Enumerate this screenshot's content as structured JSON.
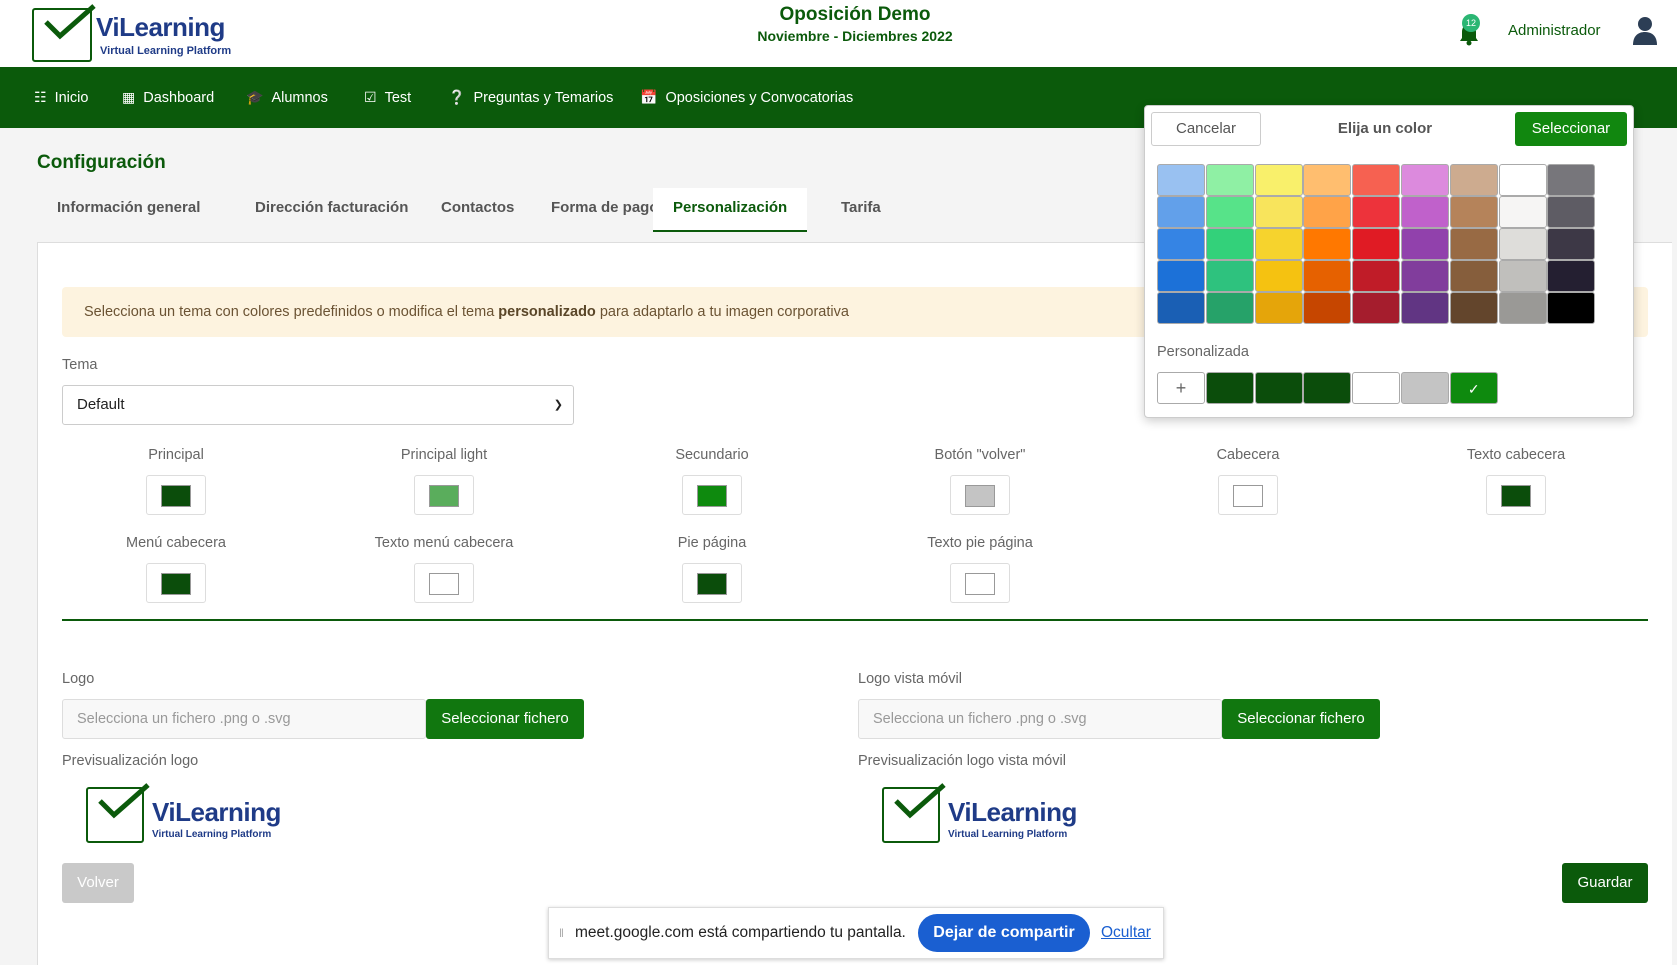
{
  "header": {
    "logo": {
      "title_vi": "Vi",
      "title_learning": "Learning",
      "subtitle": "Virtual Learning Platform"
    },
    "exam_title": "Oposición Demo",
    "exam_dates": "Noviembre - Diciembres 2022",
    "notification_count": "12",
    "user_name": "Administrador"
  },
  "nav": {
    "items": [
      {
        "label": "Inicio",
        "icon": "grid-icon"
      },
      {
        "label": "Dashboard",
        "icon": "dashboard-icon"
      },
      {
        "label": "Alumnos",
        "icon": "graduation-cap-icon"
      },
      {
        "label": "Test",
        "icon": "checkbox-icon"
      },
      {
        "label": "Preguntas y Temarios",
        "icon": "question-circle-icon"
      },
      {
        "label": "Oposiciones y Convocatorias",
        "icon": "calendar-icon"
      }
    ]
  },
  "page": {
    "title": "Configuración",
    "tabs": [
      {
        "label": "Información general"
      },
      {
        "label": "Dirección facturación"
      },
      {
        "label": "Contactos"
      },
      {
        "label": "Forma de pago"
      },
      {
        "label": "Personalización"
      },
      {
        "label": "Tarifa"
      }
    ],
    "active_tab": "Personalización"
  },
  "personalization": {
    "alert_pre": "Selecciona un tema con colores predefinidos o modifica el tema ",
    "alert_bold": "personalizado",
    "alert_post": " para adaptarlo a tu imagen corporativa",
    "theme_label": "Tema",
    "theme_value": "Default",
    "colors": [
      {
        "name": "Principal",
        "color": "#0b4d0b"
      },
      {
        "name": "Principal light",
        "color": "#5aad5c"
      },
      {
        "name": "Secundario",
        "color": "#0e8a0e"
      },
      {
        "name": "Botón \"volver\"",
        "color": "#c4c4c4"
      },
      {
        "name": "Cabecera",
        "color": "#ffffff"
      },
      {
        "name": "Texto cabecera",
        "color": "#0b4d0b"
      },
      {
        "name": "Menú cabecera",
        "color": "#0b4d0b"
      },
      {
        "name": "Texto menú cabecera",
        "color": "#ffffff"
      },
      {
        "name": "Pie página",
        "color": "#0b4d0b"
      },
      {
        "name": "Texto pie página",
        "color": "#ffffff"
      }
    ],
    "logo_label": "Logo",
    "logo_mobile_label": "Logo vista móvil",
    "file_placeholder": "Selecciona un fichero .png o .svg",
    "file_button": "Seleccionar fichero",
    "preview_logo_label": "Previsualización logo",
    "preview_logo_mobile_label": "Previsualización logo vista móvil",
    "back_button": "Volver",
    "save_button": "Guardar"
  },
  "color_picker": {
    "cancel_label": "Cancelar",
    "title": "Elija un color",
    "select_label": "Seleccionar",
    "custom_label": "Personalizada",
    "add_symbol": "+",
    "palette": [
      [
        "#99c1f1",
        "#8ff0a4",
        "#f9f06b",
        "#ffbe6f",
        "#f66151",
        "#dc8add",
        "#cdab8f",
        "#ffffff",
        "#77767b"
      ],
      [
        "#62a0ea",
        "#57e389",
        "#f8e45c",
        "#ffa348",
        "#ed333b",
        "#c061cb",
        "#b5835a",
        "#f6f5f4",
        "#5e5c64"
      ],
      [
        "#3584e4",
        "#33d17a",
        "#f6d32d",
        "#ff7800",
        "#e01b24",
        "#9141ac",
        "#986a44",
        "#deddda",
        "#3d3846"
      ],
      [
        "#1c71d8",
        "#2ec27e",
        "#f5c211",
        "#e66100",
        "#c01c28",
        "#813d9c",
        "#865e3c",
        "#c0bfbc",
        "#241f31"
      ],
      [
        "#1a5fb4",
        "#26a269",
        "#e5a50a",
        "#c64600",
        "#a51d2d",
        "#613583",
        "#63452c",
        "#9a9996",
        "#000000"
      ]
    ],
    "custom_colors": [
      "#0b4d0b",
      "#0b4d0b",
      "#0b4d0b",
      "#ffffff",
      "#c4c4c4",
      "#0e8a0e"
    ],
    "selected_custom_index": 5
  },
  "screen_share": {
    "message": "meet.google.com está compartiendo tu pantalla.",
    "stop_label": "Dejar de compartir",
    "hide_label": "Ocultar"
  }
}
